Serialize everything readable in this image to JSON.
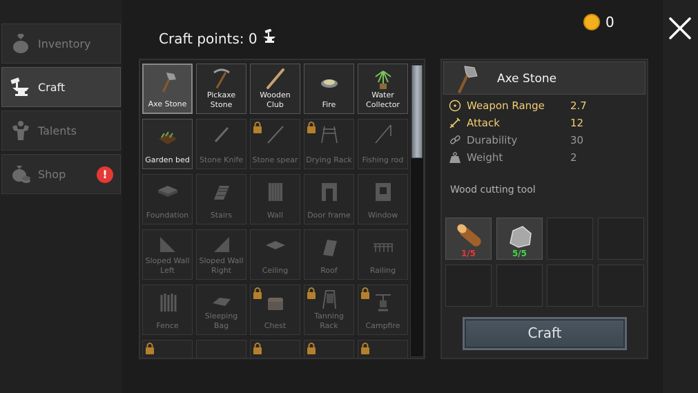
{
  "sidebar": {
    "tabs": [
      {
        "label": "Inventory",
        "active": false
      },
      {
        "label": "Craft",
        "active": true
      },
      {
        "label": "Talents",
        "active": false
      },
      {
        "label": "Shop",
        "active": false,
        "badge": "!"
      }
    ]
  },
  "header": {
    "craft_points_label": "Craft points: 0",
    "coins": "0"
  },
  "grid": {
    "items": [
      {
        "label": "Axe Stone",
        "icon": "axe-icon",
        "state": "selected"
      },
      {
        "label": "Pickaxe Stone",
        "icon": "pickaxe-icon",
        "state": "available"
      },
      {
        "label": "Wooden Club",
        "icon": "club-icon",
        "state": "available"
      },
      {
        "label": "Fire",
        "icon": "fire-icon",
        "state": "available"
      },
      {
        "label": "Water Collector",
        "icon": "water-collector-icon",
        "state": "available"
      },
      {
        "label": "Garden bed",
        "icon": "garden-bed-icon",
        "state": "available"
      },
      {
        "label": "Stone Knife",
        "icon": "knife-icon",
        "state": "unavailable"
      },
      {
        "label": "Stone spear",
        "icon": "spear-icon",
        "state": "locked"
      },
      {
        "label": "Drying Rack",
        "icon": "drying-rack-icon",
        "state": "locked"
      },
      {
        "label": "Fishing rod",
        "icon": "fishing-rod-icon",
        "state": "unavailable"
      },
      {
        "label": "Foundation",
        "icon": "foundation-icon",
        "state": "unavailable"
      },
      {
        "label": "Stairs",
        "icon": "stairs-icon",
        "state": "unavailable"
      },
      {
        "label": "Wall",
        "icon": "wall-icon",
        "state": "unavailable"
      },
      {
        "label": "Door frame",
        "icon": "door-frame-icon",
        "state": "unavailable"
      },
      {
        "label": "Window",
        "icon": "window-icon",
        "state": "unavailable"
      },
      {
        "label": "Sloped Wall Left",
        "icon": "sloped-wall-left-icon",
        "state": "unavailable"
      },
      {
        "label": "Sloped Wall Right",
        "icon": "sloped-wall-right-icon",
        "state": "unavailable"
      },
      {
        "label": "Ceiling",
        "icon": "ceiling-icon",
        "state": "unavailable"
      },
      {
        "label": "Roof",
        "icon": "roof-icon",
        "state": "unavailable"
      },
      {
        "label": "Railing",
        "icon": "railing-icon",
        "state": "unavailable"
      },
      {
        "label": "Fence",
        "icon": "fence-icon",
        "state": "unavailable"
      },
      {
        "label": "Sleeping Bag",
        "icon": "sleeping-bag-icon",
        "state": "unavailable"
      },
      {
        "label": "Chest",
        "icon": "chest-icon",
        "state": "locked"
      },
      {
        "label": "Tanning Rack",
        "icon": "tanning-rack-icon",
        "state": "locked"
      },
      {
        "label": "Campfire",
        "icon": "campfire-icon",
        "state": "locked"
      },
      {
        "label": "",
        "icon": "item-icon",
        "state": "locked"
      },
      {
        "label": "",
        "icon": "item-icon",
        "state": "unavailable"
      },
      {
        "label": "",
        "icon": "item-icon",
        "state": "locked"
      },
      {
        "label": "",
        "icon": "item-icon",
        "state": "locked"
      },
      {
        "label": "",
        "icon": "item-icon",
        "state": "locked"
      }
    ]
  },
  "detail": {
    "title": "Axe Stone",
    "stats": [
      {
        "name": "Weapon Range",
        "value": "2.7",
        "icon": "range-icon",
        "highlight": true
      },
      {
        "name": "Attack",
        "value": "12",
        "icon": "sword-icon",
        "highlight": true
      },
      {
        "name": "Durability",
        "value": "30",
        "icon": "chain-icon",
        "highlight": false
      },
      {
        "name": "Weight",
        "value": "2",
        "icon": "weight-icon",
        "highlight": false
      }
    ],
    "description": "Wood cutting tool",
    "ingredients": [
      {
        "icon": "log-icon",
        "count": "1/5",
        "enough": false
      },
      {
        "icon": "stone-icon",
        "count": "5/5",
        "enough": true
      }
    ],
    "craft_label": "Craft"
  },
  "colors": {
    "highlight": "#f3cf73",
    "missing": "#e53935",
    "enough": "#43d64a",
    "badge": "#e53935",
    "coin": "#f2b01e"
  }
}
